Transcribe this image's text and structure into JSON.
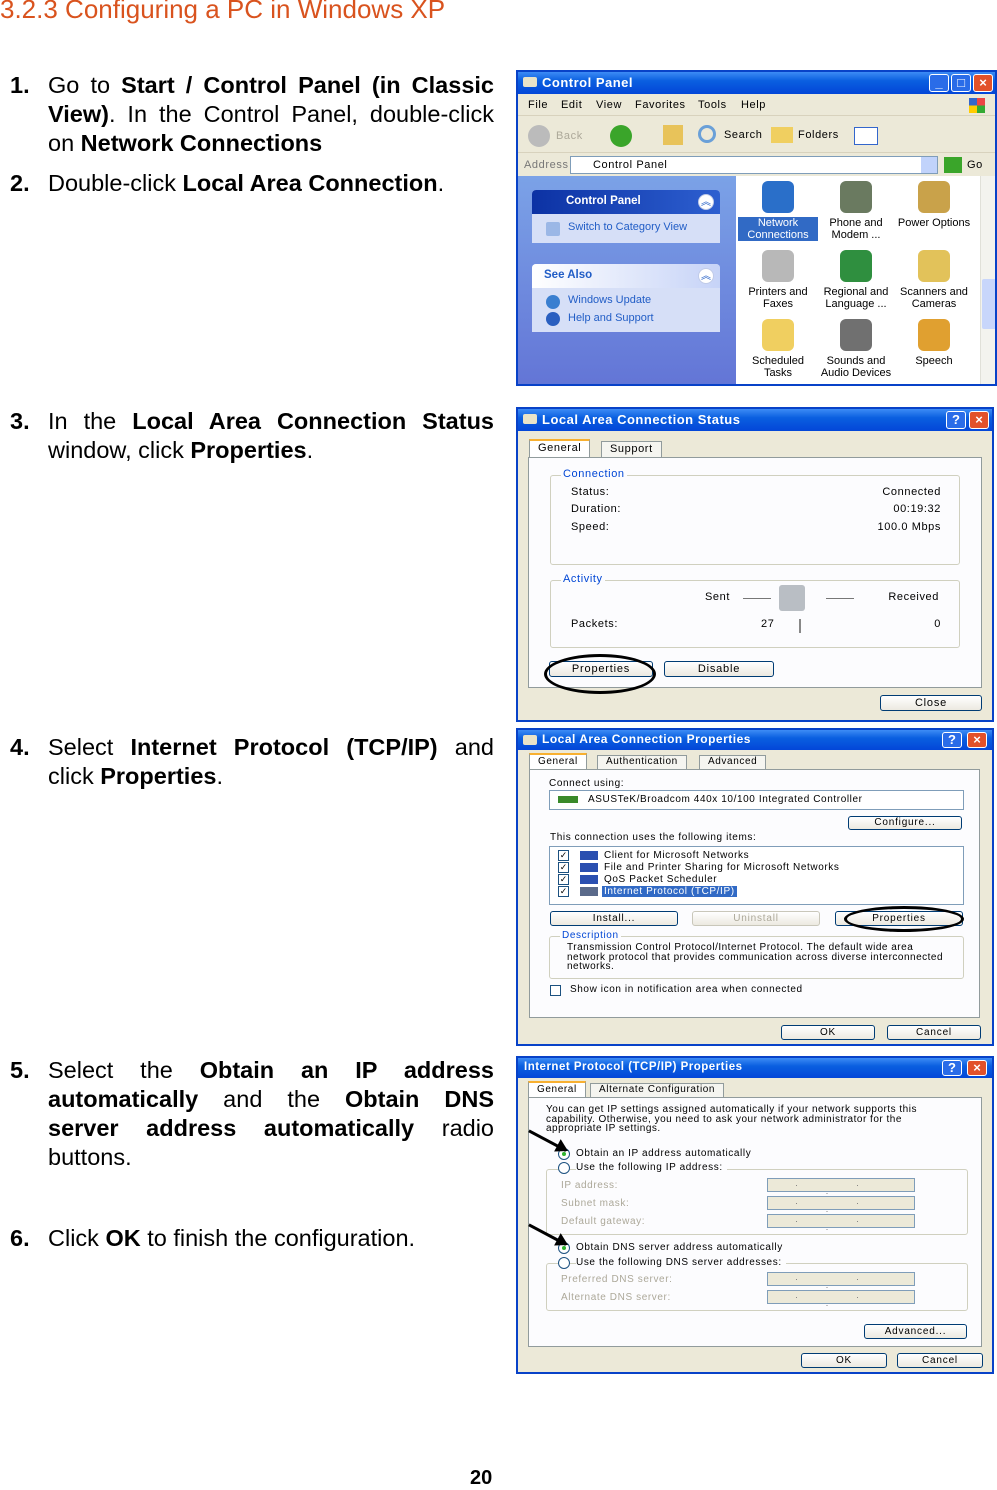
{
  "heading": "3.2.3 Configuring a PC in Windows XP",
  "steps": [
    {
      "num": "1.",
      "parts": [
        "Go to ",
        "Start / Control Panel (in Classic View)",
        ". In the Control Panel, double-click on ",
        "Network Connections"
      ]
    },
    {
      "num": "2.",
      "parts": [
        "Double-click ",
        "Local Area Connection",
        "."
      ]
    },
    {
      "num": "3.",
      "parts": [
        "In the ",
        "Local Area Connection Status",
        " window, click ",
        "Properties",
        "."
      ]
    },
    {
      "num": "4.",
      "parts": [
        "Select ",
        "Internet Protocol (TCP/IP)",
        " and click ",
        "Properties",
        "."
      ]
    },
    {
      "num": "5.",
      "parts": [
        "Select the ",
        "Obtain an IP address automatically",
        " and the ",
        "Obtain DNS server address automatically",
        " radio buttons."
      ]
    },
    {
      "num": "6.",
      "parts": [
        "Click ",
        "OK",
        " to finish the configuration."
      ]
    }
  ],
  "control_panel": {
    "title": "Control Panel",
    "menu": [
      "File",
      "Edit",
      "View",
      "Favorites",
      "Tools",
      "Help"
    ],
    "toolbar": {
      "back": "Back",
      "search": "Search",
      "folders": "Folders"
    },
    "address_label": "Address",
    "address_value": "Control Panel",
    "go": "Go",
    "task_pane": {
      "title": "Control Panel",
      "switch": "Switch to Category View",
      "see_also": "See Also",
      "links": [
        "Windows Update",
        "Help and Support"
      ]
    },
    "items": [
      {
        "label": "Network Connections",
        "selected": true,
        "color": "#2a6fc9"
      },
      {
        "label": "Phone and Modem ...",
        "color": "#6a7a60"
      },
      {
        "label": "Power Options",
        "color": "#c9a24a"
      },
      {
        "label": "Printers and Faxes",
        "color": "#b8b8b8"
      },
      {
        "label": "Regional and Language ...",
        "color": "#2f8f3f"
      },
      {
        "label": "Scanners and Cameras",
        "color": "#e2c25a"
      },
      {
        "label": "Scheduled Tasks",
        "color": "#f0cf60"
      },
      {
        "label": "Sounds and Audio Devices",
        "color": "#707070"
      },
      {
        "label": "Speech",
        "color": "#e0a030"
      }
    ]
  },
  "status_window": {
    "title": "Local Area Connection Status",
    "tabs": [
      "General",
      "Support"
    ],
    "connection_label": "Connection",
    "rows": [
      {
        "k": "Status:",
        "v": "Connected"
      },
      {
        "k": "Duration:",
        "v": "00:19:32"
      },
      {
        "k": "Speed:",
        "v": "100.0 Mbps"
      }
    ],
    "activity_label": "Activity",
    "sent": "Sent",
    "received": "Received",
    "packets": "Packets:",
    "packets_sent": "27",
    "packets_received": "0",
    "properties": "Properties",
    "disable": "Disable",
    "close": "Close"
  },
  "props_window": {
    "title": "Local Area Connection Properties",
    "tabs": [
      "General",
      "Authentication",
      "Advanced"
    ],
    "connect_using": "Connect using:",
    "adapter": "ASUSTeK/Broadcom 440x 10/100 Integrated Controller",
    "configure": "Configure...",
    "items_label": "This connection uses the following items:",
    "items": [
      "Client for Microsoft Networks",
      "File and Printer Sharing for Microsoft Networks",
      "QoS Packet Scheduler",
      "Internet Protocol (TCP/IP)"
    ],
    "install": "Install...",
    "uninstall": "Uninstall",
    "properties": "Properties",
    "description_label": "Description",
    "description": "Transmission Control Protocol/Internet Protocol. The default wide area network protocol that provides communication across diverse interconnected networks.",
    "show_icon": "Show icon in notification area when connected",
    "ok": "OK",
    "cancel": "Cancel"
  },
  "tcpip_window": {
    "title": "Internet Protocol (TCP/IP) Properties",
    "tabs": [
      "General",
      "Alternate Configuration"
    ],
    "intro": "You can get IP settings assigned automatically if your network supports this capability. Otherwise, you need to ask your network administrator for the appropriate IP settings.",
    "obtain_ip": "Obtain an IP address automatically",
    "use_ip": "Use the following IP address:",
    "ip_fields": [
      "IP address:",
      "Subnet mask:",
      "Default gateway:"
    ],
    "obtain_dns": "Obtain DNS server address automatically",
    "use_dns": "Use the following DNS server addresses:",
    "dns_fields": [
      "Preferred DNS server:",
      "Alternate DNS server:"
    ],
    "ip_placeholder": ". . .",
    "advanced": "Advanced...",
    "ok": "OK",
    "cancel": "Cancel"
  },
  "page_number": "20"
}
